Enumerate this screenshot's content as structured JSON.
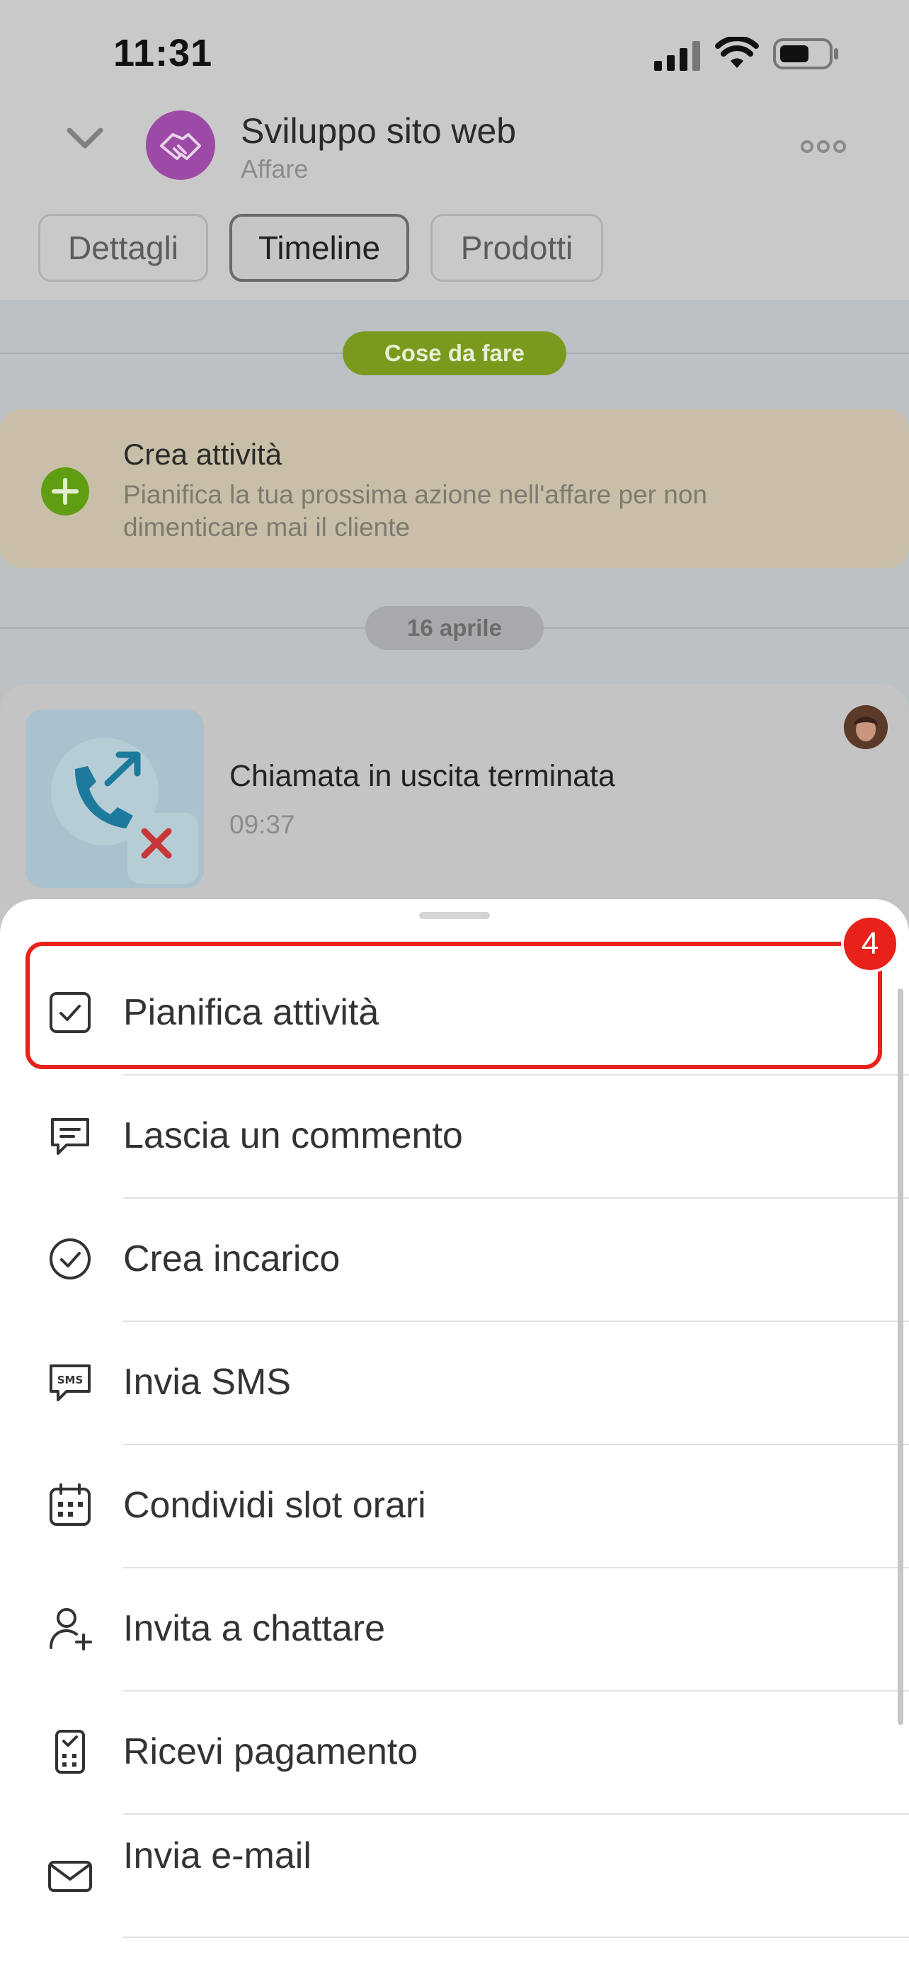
{
  "status_bar": {
    "time": "11:31"
  },
  "header": {
    "title": "Sviluppo sito web",
    "subtitle": "Affare",
    "tabs": [
      {
        "label": "Dettagli"
      },
      {
        "label": "Timeline"
      },
      {
        "label": "Prodotti"
      }
    ],
    "active_tab": "Timeline"
  },
  "timeline": {
    "todo_pill": "Cose da fare",
    "todo_card": {
      "title": "Crea attività",
      "description": "Pianifica la tua prossima azione nell'affare per non dimenticare mai il cliente"
    },
    "date_pill": "16 aprile",
    "call": {
      "title": "Chiamata in uscita terminata",
      "time": "09:37"
    }
  },
  "sheet": {
    "badge": "4",
    "items": [
      {
        "label": "Pianifica attività",
        "icon": "checkbox-icon"
      },
      {
        "label": "Lascia un commento",
        "icon": "comment-icon"
      },
      {
        "label": "Crea incarico",
        "icon": "check-circle-icon"
      },
      {
        "label": "Invia SMS",
        "icon": "sms-icon"
      },
      {
        "label": "Condividi slot orari",
        "icon": "calendar-icon"
      },
      {
        "label": "Invita a chattare",
        "icon": "add-user-icon"
      },
      {
        "label": "Ricevi pagamento",
        "icon": "payment-terminal-icon"
      },
      {
        "label": "Invia e-mail",
        "icon": "mail-icon"
      }
    ]
  },
  "colors": {
    "accent_red": "#e8211b",
    "deal_purple": "#9d4aa6",
    "todo_green": "#7a9a1e"
  }
}
